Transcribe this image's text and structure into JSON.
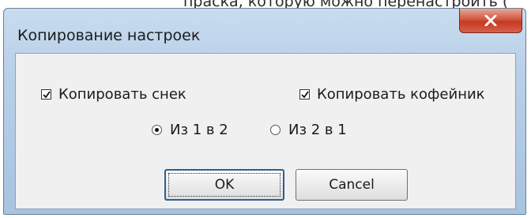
{
  "background_text": "праска, которую можно перенастроить (",
  "dialog": {
    "title": "Копирование настроек",
    "copy_snack": {
      "label": "Копировать снек",
      "checked": true
    },
    "copy_coffee": {
      "label": "Копировать кофейник",
      "checked": true
    },
    "direction": {
      "option_1_to_2": {
        "label": "Из 1 в 2",
        "selected": true
      },
      "option_2_to_1": {
        "label": "Из 2 в 1",
        "selected": false
      }
    },
    "ok_label": "OK",
    "cancel_label": "Cancel"
  },
  "colors": {
    "titlebar": "#b9d0e8",
    "close_button": "#c43a22",
    "client_area": "#f0f0f0"
  },
  "icons": {
    "close": "close-x-icon",
    "check": "checkmark-icon"
  }
}
